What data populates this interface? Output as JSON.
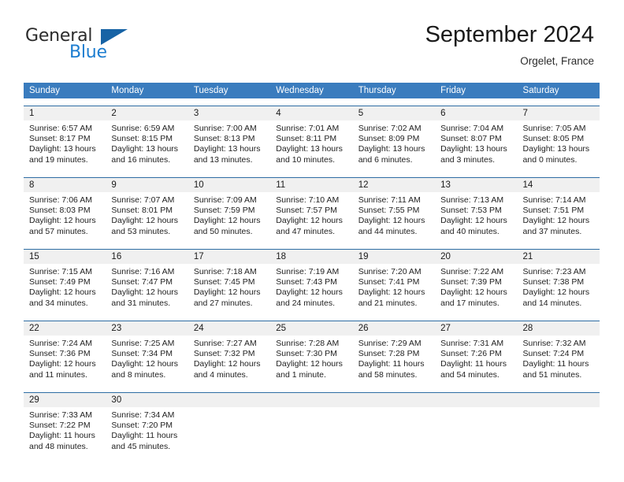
{
  "brand": {
    "line1": "General",
    "line2": "Blue",
    "triangle_icon": "triangle-logo-icon",
    "accent_color": "#1d7dd0",
    "triangle_color": "#1763a5"
  },
  "header": {
    "month_title": "September 2024",
    "location": "Orgelet, France"
  },
  "theme": {
    "header_blue": "#3a7cbe",
    "row_divider_blue": "#2e6da4",
    "date_band_gray": "#f0f0f0"
  },
  "weekdays": [
    "Sunday",
    "Monday",
    "Tuesday",
    "Wednesday",
    "Thursday",
    "Friday",
    "Saturday"
  ],
  "weeks": [
    [
      {
        "day": "1",
        "sunrise": "Sunrise: 6:57 AM",
        "sunset": "Sunset: 8:17 PM",
        "daylight_line1": "Daylight: 13 hours",
        "daylight_line2": "and 19 minutes."
      },
      {
        "day": "2",
        "sunrise": "Sunrise: 6:59 AM",
        "sunset": "Sunset: 8:15 PM",
        "daylight_line1": "Daylight: 13 hours",
        "daylight_line2": "and 16 minutes."
      },
      {
        "day": "3",
        "sunrise": "Sunrise: 7:00 AM",
        "sunset": "Sunset: 8:13 PM",
        "daylight_line1": "Daylight: 13 hours",
        "daylight_line2": "and 13 minutes."
      },
      {
        "day": "4",
        "sunrise": "Sunrise: 7:01 AM",
        "sunset": "Sunset: 8:11 PM",
        "daylight_line1": "Daylight: 13 hours",
        "daylight_line2": "and 10 minutes."
      },
      {
        "day": "5",
        "sunrise": "Sunrise: 7:02 AM",
        "sunset": "Sunset: 8:09 PM",
        "daylight_line1": "Daylight: 13 hours",
        "daylight_line2": "and 6 minutes."
      },
      {
        "day": "6",
        "sunrise": "Sunrise: 7:04 AM",
        "sunset": "Sunset: 8:07 PM",
        "daylight_line1": "Daylight: 13 hours",
        "daylight_line2": "and 3 minutes."
      },
      {
        "day": "7",
        "sunrise": "Sunrise: 7:05 AM",
        "sunset": "Sunset: 8:05 PM",
        "daylight_line1": "Daylight: 13 hours",
        "daylight_line2": "and 0 minutes."
      }
    ],
    [
      {
        "day": "8",
        "sunrise": "Sunrise: 7:06 AM",
        "sunset": "Sunset: 8:03 PM",
        "daylight_line1": "Daylight: 12 hours",
        "daylight_line2": "and 57 minutes."
      },
      {
        "day": "9",
        "sunrise": "Sunrise: 7:07 AM",
        "sunset": "Sunset: 8:01 PM",
        "daylight_line1": "Daylight: 12 hours",
        "daylight_line2": "and 53 minutes."
      },
      {
        "day": "10",
        "sunrise": "Sunrise: 7:09 AM",
        "sunset": "Sunset: 7:59 PM",
        "daylight_line1": "Daylight: 12 hours",
        "daylight_line2": "and 50 minutes."
      },
      {
        "day": "11",
        "sunrise": "Sunrise: 7:10 AM",
        "sunset": "Sunset: 7:57 PM",
        "daylight_line1": "Daylight: 12 hours",
        "daylight_line2": "and 47 minutes."
      },
      {
        "day": "12",
        "sunrise": "Sunrise: 7:11 AM",
        "sunset": "Sunset: 7:55 PM",
        "daylight_line1": "Daylight: 12 hours",
        "daylight_line2": "and 44 minutes."
      },
      {
        "day": "13",
        "sunrise": "Sunrise: 7:13 AM",
        "sunset": "Sunset: 7:53 PM",
        "daylight_line1": "Daylight: 12 hours",
        "daylight_line2": "and 40 minutes."
      },
      {
        "day": "14",
        "sunrise": "Sunrise: 7:14 AM",
        "sunset": "Sunset: 7:51 PM",
        "daylight_line1": "Daylight: 12 hours",
        "daylight_line2": "and 37 minutes."
      }
    ],
    [
      {
        "day": "15",
        "sunrise": "Sunrise: 7:15 AM",
        "sunset": "Sunset: 7:49 PM",
        "daylight_line1": "Daylight: 12 hours",
        "daylight_line2": "and 34 minutes."
      },
      {
        "day": "16",
        "sunrise": "Sunrise: 7:16 AM",
        "sunset": "Sunset: 7:47 PM",
        "daylight_line1": "Daylight: 12 hours",
        "daylight_line2": "and 31 minutes."
      },
      {
        "day": "17",
        "sunrise": "Sunrise: 7:18 AM",
        "sunset": "Sunset: 7:45 PM",
        "daylight_line1": "Daylight: 12 hours",
        "daylight_line2": "and 27 minutes."
      },
      {
        "day": "18",
        "sunrise": "Sunrise: 7:19 AM",
        "sunset": "Sunset: 7:43 PM",
        "daylight_line1": "Daylight: 12 hours",
        "daylight_line2": "and 24 minutes."
      },
      {
        "day": "19",
        "sunrise": "Sunrise: 7:20 AM",
        "sunset": "Sunset: 7:41 PM",
        "daylight_line1": "Daylight: 12 hours",
        "daylight_line2": "and 21 minutes."
      },
      {
        "day": "20",
        "sunrise": "Sunrise: 7:22 AM",
        "sunset": "Sunset: 7:39 PM",
        "daylight_line1": "Daylight: 12 hours",
        "daylight_line2": "and 17 minutes."
      },
      {
        "day": "21",
        "sunrise": "Sunrise: 7:23 AM",
        "sunset": "Sunset: 7:38 PM",
        "daylight_line1": "Daylight: 12 hours",
        "daylight_line2": "and 14 minutes."
      }
    ],
    [
      {
        "day": "22",
        "sunrise": "Sunrise: 7:24 AM",
        "sunset": "Sunset: 7:36 PM",
        "daylight_line1": "Daylight: 12 hours",
        "daylight_line2": "and 11 minutes."
      },
      {
        "day": "23",
        "sunrise": "Sunrise: 7:25 AM",
        "sunset": "Sunset: 7:34 PM",
        "daylight_line1": "Daylight: 12 hours",
        "daylight_line2": "and 8 minutes."
      },
      {
        "day": "24",
        "sunrise": "Sunrise: 7:27 AM",
        "sunset": "Sunset: 7:32 PM",
        "daylight_line1": "Daylight: 12 hours",
        "daylight_line2": "and 4 minutes."
      },
      {
        "day": "25",
        "sunrise": "Sunrise: 7:28 AM",
        "sunset": "Sunset: 7:30 PM",
        "daylight_line1": "Daylight: 12 hours",
        "daylight_line2": "and 1 minute."
      },
      {
        "day": "26",
        "sunrise": "Sunrise: 7:29 AM",
        "sunset": "Sunset: 7:28 PM",
        "daylight_line1": "Daylight: 11 hours",
        "daylight_line2": "and 58 minutes."
      },
      {
        "day": "27",
        "sunrise": "Sunrise: 7:31 AM",
        "sunset": "Sunset: 7:26 PM",
        "daylight_line1": "Daylight: 11 hours",
        "daylight_line2": "and 54 minutes."
      },
      {
        "day": "28",
        "sunrise": "Sunrise: 7:32 AM",
        "sunset": "Sunset: 7:24 PM",
        "daylight_line1": "Daylight: 11 hours",
        "daylight_line2": "and 51 minutes."
      }
    ],
    [
      {
        "day": "29",
        "sunrise": "Sunrise: 7:33 AM",
        "sunset": "Sunset: 7:22 PM",
        "daylight_line1": "Daylight: 11 hours",
        "daylight_line2": "and 48 minutes."
      },
      {
        "day": "30",
        "sunrise": "Sunrise: 7:34 AM",
        "sunset": "Sunset: 7:20 PM",
        "daylight_line1": "Daylight: 11 hours",
        "daylight_line2": "and 45 minutes."
      },
      {
        "day": "",
        "sunrise": "",
        "sunset": "",
        "daylight_line1": "",
        "daylight_line2": ""
      },
      {
        "day": "",
        "sunrise": "",
        "sunset": "",
        "daylight_line1": "",
        "daylight_line2": ""
      },
      {
        "day": "",
        "sunrise": "",
        "sunset": "",
        "daylight_line1": "",
        "daylight_line2": ""
      },
      {
        "day": "",
        "sunrise": "",
        "sunset": "",
        "daylight_line1": "",
        "daylight_line2": ""
      },
      {
        "day": "",
        "sunrise": "",
        "sunset": "",
        "daylight_line1": "",
        "daylight_line2": ""
      }
    ]
  ]
}
